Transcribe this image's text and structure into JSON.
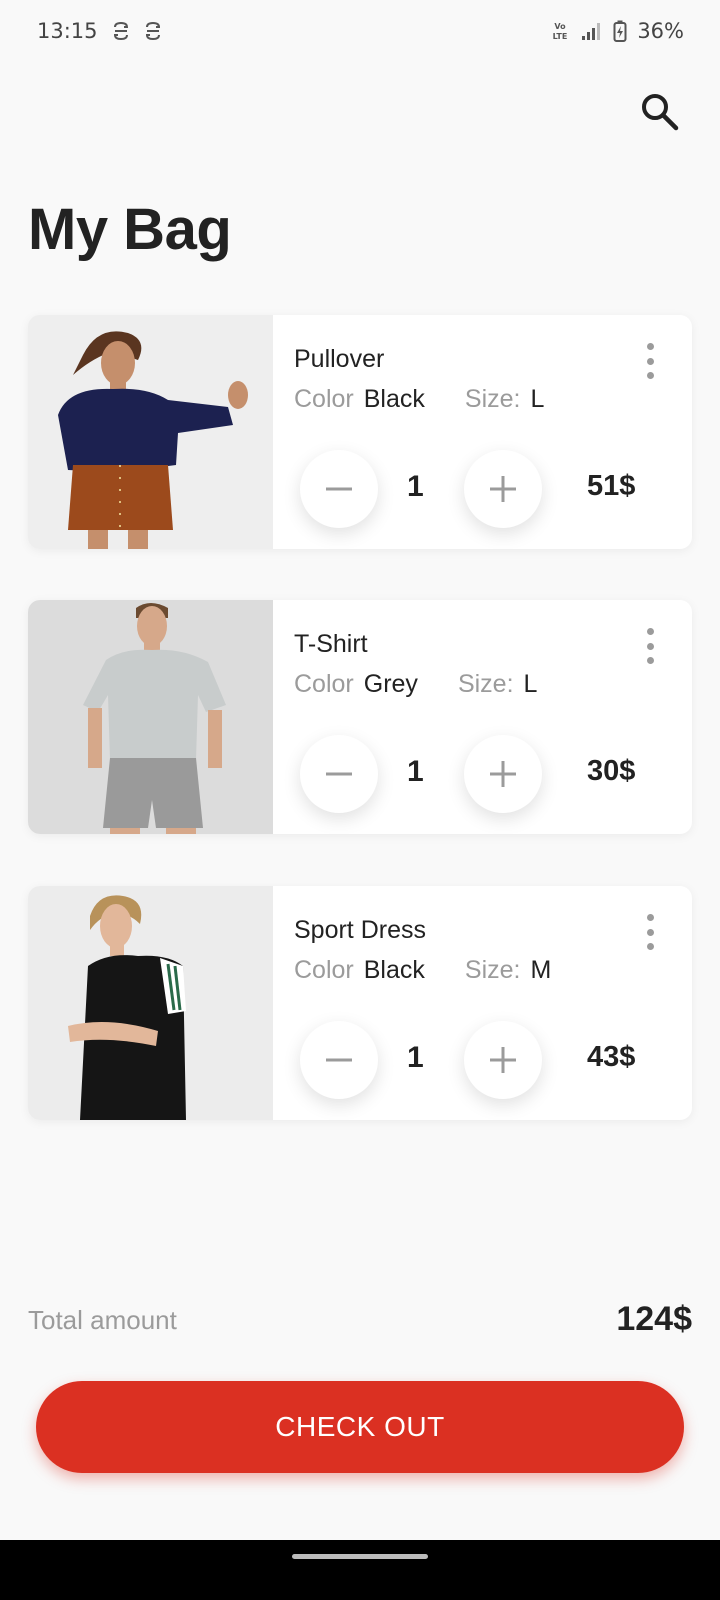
{
  "status_bar": {
    "time": "13:15",
    "network_label": "VoLTE",
    "battery": "36%"
  },
  "header": {
    "title": "My Bag",
    "search_icon": "search-icon"
  },
  "items": [
    {
      "name": "Pullover",
      "color_label": "Color",
      "color": "Black",
      "size_label": "Size:",
      "size": "L",
      "quantity": "1",
      "price": "51$"
    },
    {
      "name": "T-Shirt",
      "color_label": "Color",
      "color": "Grey",
      "size_label": "Size:",
      "size": "L",
      "quantity": "1",
      "price": "30$"
    },
    {
      "name": "Sport Dress",
      "color_label": "Color",
      "color": "Black",
      "size_label": "Size:",
      "size": "M",
      "quantity": "1",
      "price": "43$"
    }
  ],
  "summary": {
    "total_label": "Total amount",
    "total_value": "124$"
  },
  "checkout": {
    "label": "CHECK OUT"
  },
  "colors": {
    "accent": "#db3022",
    "background": "#f9f9f9",
    "muted_text": "#9b9b9b"
  }
}
